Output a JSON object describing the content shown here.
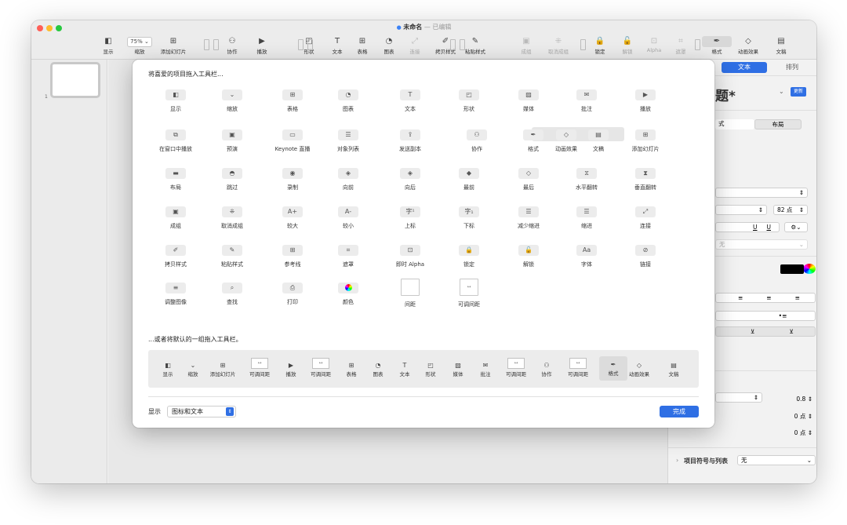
{
  "window": {
    "title": "未命名",
    "title_suffix": "— 已编辑",
    "traffic": {
      "close": "#ff5f57",
      "min": "#febc2e",
      "max": "#28c840"
    }
  },
  "toolbar": {
    "zoom_value": "75% ⌄",
    "items": [
      {
        "label": "显示",
        "icon": "sidebar-icon",
        "glyph": "◧"
      },
      {
        "label": "缩放",
        "icon": "zoom-icon",
        "glyph": ""
      },
      {
        "label": "添加幻灯片",
        "icon": "add-slide-icon",
        "glyph": "⊞"
      },
      {
        "label": "协作",
        "icon": "collaborate-icon",
        "glyph": "⚇"
      },
      {
        "label": "播放",
        "icon": "play-icon",
        "glyph": "▶"
      },
      {
        "label": "形状",
        "icon": "shape-icon",
        "glyph": "◰"
      },
      {
        "label": "文本",
        "icon": "text-icon",
        "glyph": "T"
      },
      {
        "label": "表格",
        "icon": "table-icon",
        "glyph": "⊞"
      },
      {
        "label": "图表",
        "icon": "chart-icon",
        "glyph": "◔"
      },
      {
        "label": "连接",
        "icon": "connect-icon",
        "glyph": "⤢"
      },
      {
        "label": "拷贝样式",
        "icon": "copy-style-icon",
        "glyph": "✐"
      },
      {
        "label": "粘贴样式",
        "icon": "paste-style-icon",
        "glyph": "✎"
      },
      {
        "label": "成组",
        "icon": "group-icon",
        "glyph": "▣"
      },
      {
        "label": "取消成组",
        "icon": "ungroup-icon",
        "glyph": "⁜"
      },
      {
        "label": "锁定",
        "icon": "lock-icon",
        "glyph": "🔒"
      },
      {
        "label": "解锁",
        "icon": "unlock-icon",
        "glyph": "🔓"
      },
      {
        "label": "Alpha",
        "icon": "alpha-icon",
        "glyph": "⊡"
      },
      {
        "label": "遮罩",
        "icon": "mask-icon",
        "glyph": "⌗"
      },
      {
        "label": "格式",
        "icon": "format-icon",
        "glyph": "✒"
      },
      {
        "label": "动画效果",
        "icon": "animate-icon",
        "glyph": "◇"
      },
      {
        "label": "文稿",
        "icon": "document-icon",
        "glyph": "▤"
      }
    ]
  },
  "sidebar": {
    "slide_number": "1"
  },
  "inspector": {
    "tab_text": "文本",
    "tab_arrange": "排列",
    "title_style": "题*",
    "update_button": "更新",
    "subtab_style": "式",
    "subtab_layout": "布局",
    "size_value": "82 点",
    "underline_1": "U",
    "underline_2": "U",
    "none_label": "无",
    "spacing_value": "0.8",
    "before_value": "0 点",
    "after_value": "0 点",
    "bullets_label": "项目符号与列表",
    "bullets_value": "无",
    "text_color": "#000000"
  },
  "sheet": {
    "heading": "将喜爱的项目拖入工具栏...",
    "default_heading": "...或者将默认的一组拖入工具栏。",
    "display_label": "显示",
    "display_value": "图标和文本",
    "done_button": "完成",
    "rows": [
      [
        {
          "label": "显示",
          "icon": "sidebar-icon",
          "glyph": "◧"
        },
        {
          "label": "缩放",
          "icon": "zoom-icon",
          "glyph": "⌄"
        },
        {
          "label": "表格",
          "icon": "table-icon",
          "glyph": "⊞"
        },
        {
          "label": "图表",
          "icon": "chart-icon",
          "glyph": "◔"
        },
        {
          "label": "文本",
          "icon": "text-icon",
          "glyph": "T"
        },
        {
          "label": "形状",
          "icon": "shape-icon",
          "glyph": "◰"
        },
        {
          "label": "媒体",
          "icon": "media-icon",
          "glyph": "▨"
        },
        {
          "label": "批注",
          "icon": "comment-icon",
          "glyph": "✉"
        },
        {
          "label": "播放",
          "icon": "play-icon",
          "glyph": "▶"
        }
      ],
      [
        {
          "label": "在窗口中播放",
          "icon": "play-in-window-icon",
          "glyph": "⧉"
        },
        {
          "label": "预演",
          "icon": "rehearse-icon",
          "glyph": "▣"
        },
        {
          "label": "Keynote 直播",
          "icon": "keynote-live-icon",
          "glyph": "▭"
        },
        {
          "label": "对象列表",
          "icon": "object-list-icon",
          "glyph": "☰"
        },
        {
          "label": "发送副本",
          "icon": "send-copy-icon",
          "glyph": "⇪"
        },
        {
          "label": "协作",
          "icon": "collaborate-icon",
          "glyph": "⚇"
        },
        {
          "label": "格式",
          "icon": "format-icon",
          "glyph": "✒"
        },
        {
          "label": "动画效果",
          "icon": "animate-icon",
          "glyph": "◇"
        },
        {
          "label": "文稿",
          "icon": "document-icon",
          "glyph": "▤"
        },
        {
          "label": "添加幻灯片",
          "icon": "add-slide-icon",
          "glyph": "⊞"
        }
      ],
      [
        {
          "label": "布局",
          "icon": "layout-icon",
          "glyph": "▬"
        },
        {
          "label": "跳过",
          "icon": "skip-icon",
          "glyph": "◓"
        },
        {
          "label": "录制",
          "icon": "record-icon",
          "glyph": "◉"
        },
        {
          "label": "向前",
          "icon": "forward-icon",
          "glyph": "◈"
        },
        {
          "label": "向后",
          "icon": "backward-icon",
          "glyph": "◈"
        },
        {
          "label": "最前",
          "icon": "front-icon",
          "glyph": "◆"
        },
        {
          "label": "最后",
          "icon": "back-icon",
          "glyph": "◇"
        },
        {
          "label": "水平翻转",
          "icon": "flip-horizontal-icon",
          "glyph": "⧖"
        },
        {
          "label": "垂直翻转",
          "icon": "flip-vertical-icon",
          "glyph": "⧗"
        }
      ],
      [
        {
          "label": "成组",
          "icon": "group-icon",
          "glyph": "▣"
        },
        {
          "label": "取消成组",
          "icon": "ungroup-icon",
          "glyph": "⁜"
        },
        {
          "label": "较大",
          "icon": "bigger-icon",
          "glyph": "A+"
        },
        {
          "label": "较小",
          "icon": "smaller-icon",
          "glyph": "A-"
        },
        {
          "label": "上标",
          "icon": "superscript-icon",
          "glyph": "字¹"
        },
        {
          "label": "下标",
          "icon": "subscript-icon",
          "glyph": "字₁"
        },
        {
          "label": "减少缩进",
          "icon": "decrease-indent-icon",
          "glyph": "☰"
        },
        {
          "label": "缩进",
          "icon": "indent-icon",
          "glyph": "☰"
        },
        {
          "label": "连接",
          "icon": "connect-icon",
          "glyph": "⤢"
        }
      ],
      [
        {
          "label": "拷贝样式",
          "icon": "copy-style-icon",
          "glyph": "✐"
        },
        {
          "label": "粘贴样式",
          "icon": "paste-style-icon",
          "glyph": "✎"
        },
        {
          "label": "参考线",
          "icon": "guides-icon",
          "glyph": "⊞"
        },
        {
          "label": "遮罩",
          "icon": "mask-icon",
          "glyph": "⌗"
        },
        {
          "label": "即时 Alpha",
          "icon": "alpha-icon",
          "glyph": "⊡"
        },
        {
          "label": "锁定",
          "icon": "lock-icon",
          "glyph": "🔒"
        },
        {
          "label": "解锁",
          "icon": "unlock-icon",
          "glyph": "🔓"
        },
        {
          "label": "字体",
          "icon": "fonts-icon",
          "glyph": "Aa"
        },
        {
          "label": "链接",
          "icon": "link-icon",
          "glyph": "⊘"
        }
      ],
      [
        {
          "label": "调整图像",
          "icon": "adjust-image-icon",
          "glyph": "≡"
        },
        {
          "label": "查找",
          "icon": "find-icon",
          "glyph": "⌕"
        },
        {
          "label": "打印",
          "icon": "print-icon",
          "glyph": "⎙"
        },
        {
          "label": "颜色",
          "icon": "colors-icon",
          "glyph": "◉"
        },
        {
          "label": "间距",
          "icon": "space-icon",
          "glyph": ""
        },
        {
          "label": "可调间距",
          "icon": "flexible-space-icon",
          "glyph": "↔"
        }
      ]
    ],
    "default_set": [
      {
        "label": "显示",
        "icon": "sidebar-icon",
        "glyph": "◧"
      },
      {
        "label": "缩放",
        "icon": "zoom-icon",
        "glyph": "⌄"
      },
      {
        "label": "添加幻灯片",
        "icon": "add-slide-icon",
        "glyph": "⊞"
      },
      {
        "label": "可调间距",
        "icon": "flexible-space-icon",
        "glyph": "↔",
        "boxed": true
      },
      {
        "label": "播放",
        "icon": "play-icon",
        "glyph": "▶"
      },
      {
        "label": "可调间距",
        "icon": "flexible-space-icon",
        "glyph": "↔",
        "boxed": true
      },
      {
        "label": "表格",
        "icon": "table-icon",
        "glyph": "⊞"
      },
      {
        "label": "图表",
        "icon": "chart-icon",
        "glyph": "◔"
      },
      {
        "label": "文本",
        "icon": "text-icon",
        "glyph": "T"
      },
      {
        "label": "形状",
        "icon": "shape-icon",
        "glyph": "◰"
      },
      {
        "label": "媒体",
        "icon": "media-icon",
        "glyph": "▨"
      },
      {
        "label": "批注",
        "icon": "comment-icon",
        "glyph": "✉"
      },
      {
        "label": "可调间距",
        "icon": "flexible-space-icon",
        "glyph": "↔",
        "boxed": true
      },
      {
        "label": "协作",
        "icon": "collaborate-icon",
        "glyph": "⚇"
      },
      {
        "label": "可调间距",
        "icon": "flexible-space-icon",
        "glyph": "↔",
        "boxed": true
      },
      {
        "label": "格式",
        "icon": "format-icon",
        "glyph": "✒"
      },
      {
        "label": "动画效果",
        "icon": "animate-icon",
        "glyph": "◇"
      },
      {
        "label": "文稿",
        "icon": "document-icon",
        "glyph": "▤"
      }
    ]
  }
}
